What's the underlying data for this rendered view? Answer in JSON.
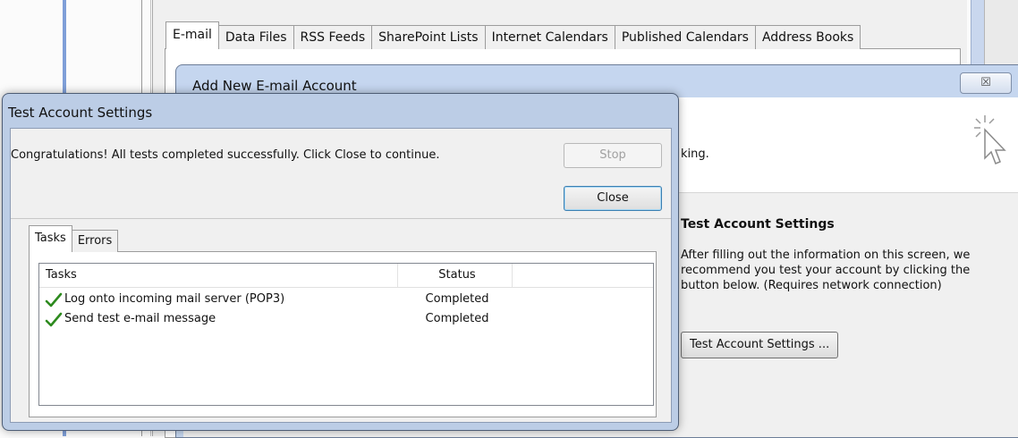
{
  "account_dialog": {
    "tabs": [
      {
        "label": "E-mail"
      },
      {
        "label": "Data Files"
      },
      {
        "label": "RSS Feeds"
      },
      {
        "label": "SharePoint Lists"
      },
      {
        "label": "Internet Calendars"
      },
      {
        "label": "Published Calendars"
      },
      {
        "label": "Address Books"
      }
    ]
  },
  "add_account": {
    "title": "Add New E-mail Account",
    "close_glyph": "☒",
    "partial_text": "king.",
    "test_section": {
      "heading": "Test Account Settings",
      "description": "After filling out the information on this screen, we recommend you test your account by clicking the button below. (Requires network connection)",
      "button_label": "Test Account Settings ..."
    },
    "cursor_icon": "cursor-pointer-icon"
  },
  "test_window": {
    "title": "Test Account Settings",
    "message": "Congratulations! All tests completed successfully. Click Close to continue.",
    "stop_label": "Stop",
    "close_label": "Close",
    "tabs": [
      {
        "label": "Tasks"
      },
      {
        "label": "Errors"
      }
    ],
    "columns": {
      "tasks": "Tasks",
      "status": "Status"
    },
    "rows": [
      {
        "task": "Log onto incoming mail server (POP3)",
        "status": "Completed"
      },
      {
        "task": "Send test e-mail message",
        "status": "Completed"
      }
    ],
    "check_color": "#2d8a1e"
  }
}
